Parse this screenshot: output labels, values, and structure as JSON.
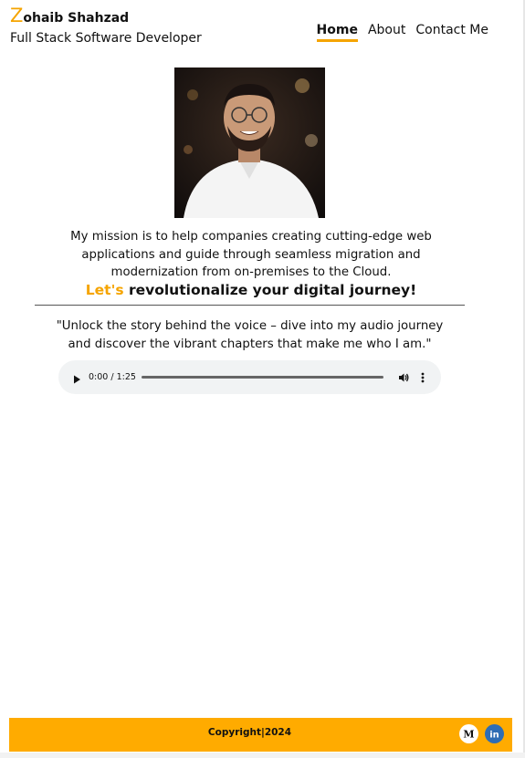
{
  "header": {
    "brand_initial": "Z",
    "brand_rest": "ohaib Shahzad",
    "subtitle": "Full Stack Software Developer"
  },
  "nav": {
    "home": "Home",
    "about": "About",
    "contact": "Contact Me",
    "active": "Home"
  },
  "hero": {
    "photo_icon": "profile-photo",
    "mission": "My mission is to help companies creating cutting-edge web applications and guide through seamless migration and modernization from on-premises to the Cloud.",
    "tagline_accent": "Let's",
    "tagline_rest": " revolutionalize your digital journey!"
  },
  "audio_section": {
    "quote": "\"Unlock the story behind the voice – dive into my audio journey and discover the vibrant chapters that make me who I am.\"",
    "time": "0:00 / 1:25",
    "progress": 0
  },
  "footer": {
    "copyright": "Copyright|2024",
    "icons": [
      "medium-icon",
      "linkedin-icon"
    ],
    "medium_glyph": "M",
    "linkedin_glyph": "in"
  },
  "colors": {
    "accent": "#f5a400",
    "footer_bg": "#ffab00",
    "linkedin": "#2e6db4"
  }
}
